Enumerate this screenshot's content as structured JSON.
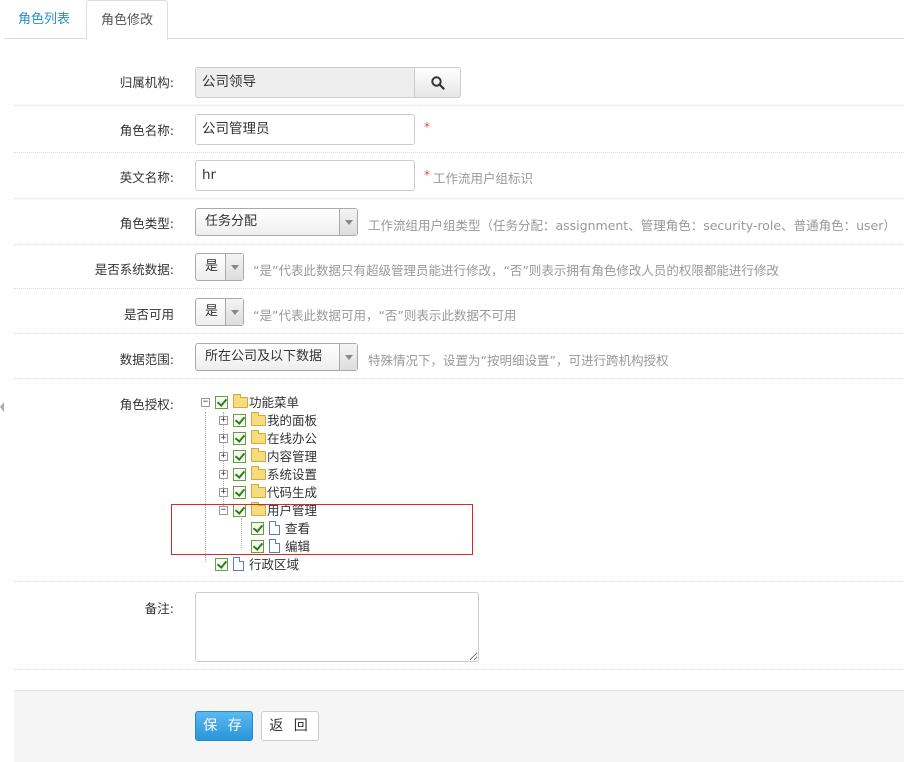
{
  "tabs": [
    {
      "label": "角色列表",
      "active": false
    },
    {
      "label": "角色修改",
      "active": true
    }
  ],
  "form": {
    "org": {
      "label": "归属机构:",
      "value": "公司领导"
    },
    "name": {
      "label": "角色名称:",
      "value": "公司管理员",
      "required": "*"
    },
    "enname": {
      "label": "英文名称:",
      "value": "hr",
      "required": "*",
      "help": "工作流用户组标识"
    },
    "roletype": {
      "label": "角色类型:",
      "value": "任务分配",
      "help": "工作流组用户组类型（任务分配：assignment、管理角色：security-role、普通角色：user）"
    },
    "sysdata": {
      "label": "是否系统数据:",
      "value": "是",
      "help": "“是”代表此数据只有超级管理员能进行修改，“否”则表示拥有角色修改人员的权限都能进行修改"
    },
    "useable": {
      "label": "是否可用",
      "value": "是",
      "help": "“是”代表此数据可用，“否”则表示此数据不可用"
    },
    "datascope": {
      "label": "数据范围:",
      "value": "所在公司及以下数据",
      "help": "特殊情况下，设置为“按明细设置”，可进行跨机构授权"
    },
    "auth": {
      "label": "角色授权:"
    },
    "remarks": {
      "label": "备注:",
      "value": ""
    }
  },
  "tree": {
    "root": "功能菜单",
    "children": [
      "我的面板",
      "在线办公",
      "内容管理",
      "系统设置",
      "代码生成",
      "用户管理"
    ],
    "user_mgmt_children": [
      "查看",
      "编辑"
    ],
    "sibling": "行政区域"
  },
  "buttons": {
    "save": "保 存",
    "back": "返 回"
  },
  "colors": {
    "primary": "#2a95d8",
    "required": "#d9534f",
    "highlight": "#d9262c",
    "link": "#2a8fc9"
  }
}
